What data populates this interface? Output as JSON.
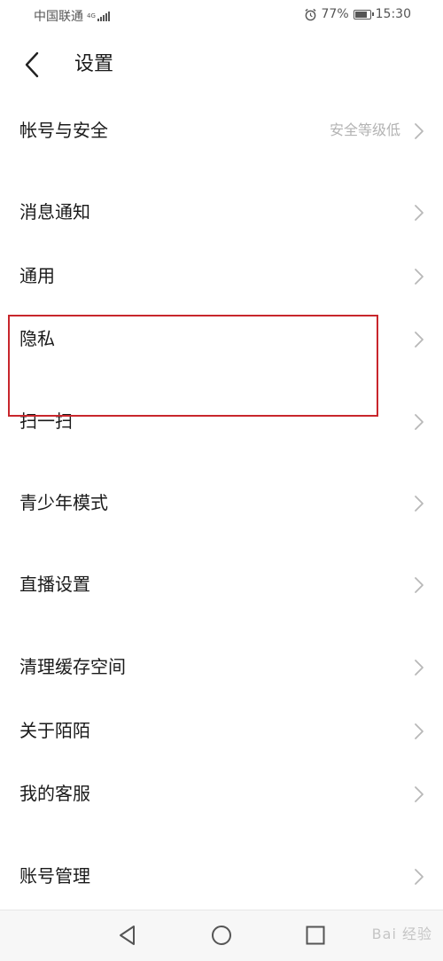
{
  "status_bar": {
    "carrier": "中国联通",
    "network_type": "4G",
    "battery_percent": "77%",
    "time": "15:30"
  },
  "header": {
    "title": "设置"
  },
  "menu": {
    "items": [
      {
        "label": "帐号与安全",
        "value": "安全等级低"
      },
      {
        "label": "消息通知"
      },
      {
        "label": "通用"
      },
      {
        "label": "隐私"
      },
      {
        "label": "扫一扫"
      },
      {
        "label": "青少年模式"
      },
      {
        "label": "直播设置"
      },
      {
        "label": "清理缓存空间"
      },
      {
        "label": "关于陌陌"
      },
      {
        "label": "我的客服"
      },
      {
        "label": "账号管理"
      }
    ]
  },
  "watermark": {
    "text": "Bai 经验"
  },
  "colors": {
    "highlight": "#c8262c",
    "chevron": "#b8b8b8",
    "secondary_text": "#b3b3b3"
  }
}
